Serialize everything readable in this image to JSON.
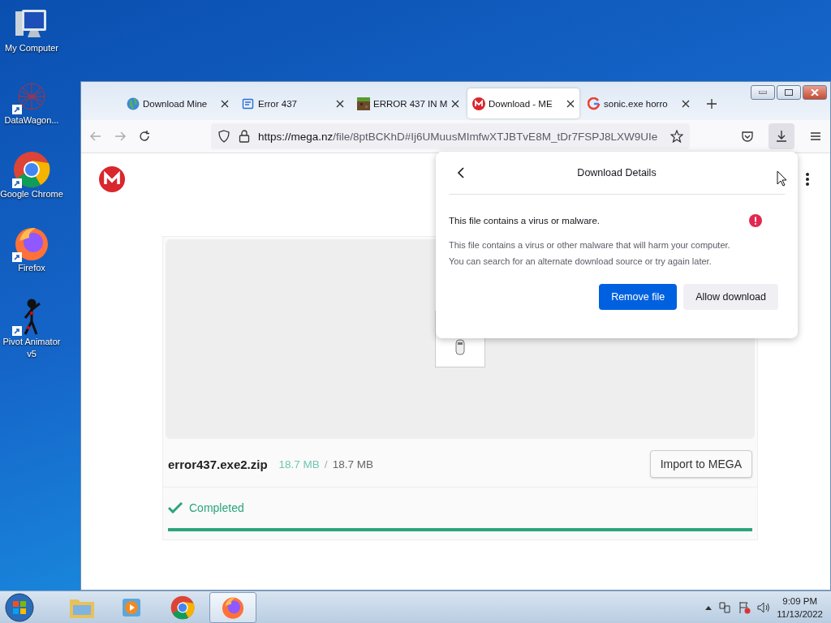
{
  "desktop": {
    "icons": [
      {
        "label": "My Computer",
        "kind": "computer",
        "shortcut": false
      },
      {
        "label": "DataWagon...",
        "kind": "web",
        "shortcut": true
      },
      {
        "label": "Google Chrome",
        "kind": "chrome",
        "shortcut": true
      },
      {
        "label": "Firefox",
        "kind": "firefox",
        "shortcut": true
      },
      {
        "label": "Pivot Animator v5",
        "kind": "stickman",
        "shortcut": true
      }
    ]
  },
  "browser": {
    "tabs": [
      {
        "label": "Download Mine",
        "kind": "globe",
        "selected": false
      },
      {
        "label": "Error 437",
        "kind": "doc",
        "selected": false
      },
      {
        "label": "ERROR 437 IN M",
        "kind": "pixel",
        "selected": false
      },
      {
        "label": "Download - ME",
        "kind": "mega",
        "selected": true
      },
      {
        "label": "sonic.exe horro",
        "kind": "google",
        "selected": false
      }
    ],
    "url_host": "https://mega.nz",
    "url_path": "/file/8ptBCKhD#Ij6UMuusMImfwXTJBTvE8M_tDr7FSPJ8LXW9UIe"
  },
  "page": {
    "file_name": "error437.exe2.zip",
    "downloaded": "18.7 MB",
    "separator": "/",
    "total": "18.7 MB",
    "import_button": "Import to MEGA",
    "status": "Completed",
    "progress": {
      "level": 1
    }
  },
  "popup": {
    "title": "Download Details",
    "heading": "This file contains a virus or malware.",
    "lines": [
      "This file contains a virus or other malware that will harm your computer.",
      "You can search for an alternate download source or try again later."
    ],
    "buttons": [
      {
        "label": "Remove file",
        "kind": "primary"
      },
      {
        "label": "Allow download",
        "kind": "secondary"
      }
    ]
  },
  "taskbar": {
    "apps": [
      {
        "kind": "folder",
        "selected": false
      },
      {
        "kind": "media",
        "selected": false
      },
      {
        "kind": "chrome",
        "selected": false
      },
      {
        "kind": "firefox",
        "selected": true
      }
    ],
    "time": "9:09 PM",
    "date": "11/13/2022"
  }
}
